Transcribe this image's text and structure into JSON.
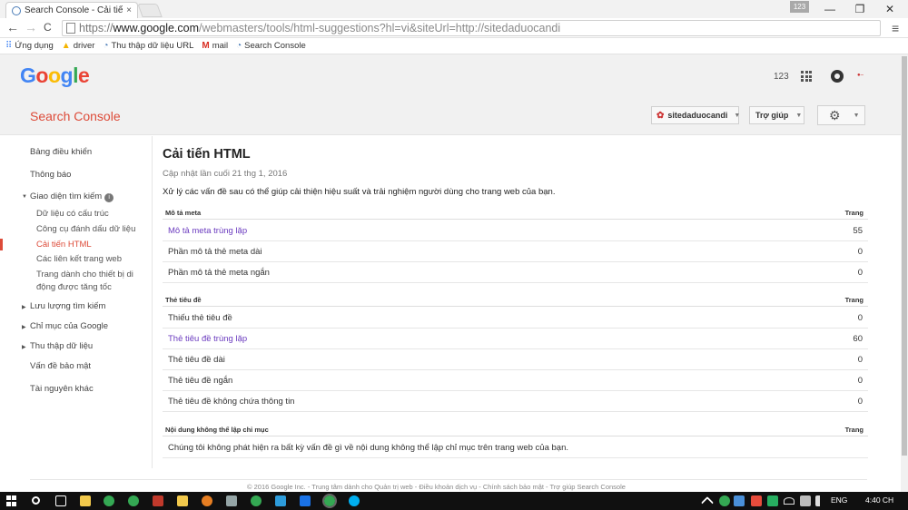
{
  "browser": {
    "tab_title": "Search Console - Cải tiến",
    "tab_close": "×",
    "profile_badge": "123",
    "win_minimize": "—",
    "win_maximize": "❐",
    "win_close": "✕",
    "nav_back": "←",
    "nav_forward": "→",
    "nav_reload": "C",
    "url_scheme": "https://",
    "url_host": "www.google.com",
    "url_rest": "/webmasters/tools/html-suggestions?hl=vi&siteUrl=http://sitedaduocandi",
    "menu": "≡"
  },
  "bookmarks": [
    {
      "label": "Ứng dụng",
      "icon": "apps-icon"
    },
    {
      "label": "driver",
      "icon": "drive-icon"
    },
    {
      "label": "Thu thập dữ liệu URL",
      "icon": "search-console-icon"
    },
    {
      "label": "mail",
      "icon": "gmail-icon"
    },
    {
      "label": "Search Console",
      "icon": "search-console-icon"
    }
  ],
  "header": {
    "logo_letters": [
      "G",
      "o",
      "o",
      "g",
      "l",
      "e"
    ],
    "logo_colors": [
      "#4285f4",
      "#ea4335",
      "#fbbc05",
      "#4285f4",
      "#34a853",
      "#ea4335"
    ],
    "count": "123",
    "brand": "Search Console",
    "site_selector": "sitedaduocandi",
    "help_label": "Trợ giúp",
    "caret": "▼",
    "gear": "⚙"
  },
  "sidebar": {
    "dashboard": "Bảng điều khiển",
    "messages": "Thông báo",
    "search_appearance": "Giao diện tìm kiếm",
    "info": "i",
    "sub": {
      "structured_data": "Dữ liệu có cấu trúc",
      "data_highlighter": "Công cụ đánh dấu dữ liệu",
      "html_improvements": "Cải tiến HTML",
      "sitelinks": "Các liên kết trang web",
      "amp_line1": "Trang dành cho thiết bị di",
      "amp_line2": "động được tăng tốc"
    },
    "search_traffic": "Lưu lượng tìm kiếm",
    "google_index": "Chỉ mục của Google",
    "crawl": "Thu thập dữ liệu",
    "security": "Vấn đề bảo mật",
    "other": "Tài nguyên khác",
    "expanded_arrow": "▼",
    "collapsed_arrow": "▶"
  },
  "main": {
    "title": "Cải tiến HTML",
    "updated": "Cập nhật lần cuối 21 thg 1, 2016",
    "intro": "Xử lý các vấn đề sau có thể giúp cải thiện hiệu suất và trải nghiệm người dùng cho trang web của bạn.",
    "sections": [
      {
        "heading": "Mô tả meta",
        "col": "Trang",
        "rows": [
          {
            "label": "Mô tả meta trùng lặp",
            "value": "55",
            "link": true
          },
          {
            "label": "Phần mô tả thẻ meta dài",
            "value": "0",
            "link": false
          },
          {
            "label": "Phần mô tả thẻ meta ngắn",
            "value": "0",
            "link": false
          }
        ]
      },
      {
        "heading": "Thẻ tiêu đề",
        "col": "Trang",
        "rows": [
          {
            "label": "Thiếu thẻ tiêu đề",
            "value": "0",
            "link": false
          },
          {
            "label": "Thẻ tiêu đề trùng lặp",
            "value": "60",
            "link": true
          },
          {
            "label": "Thẻ tiêu đề dài",
            "value": "0",
            "link": false
          },
          {
            "label": "Thẻ tiêu đề ngắn",
            "value": "0",
            "link": false
          },
          {
            "label": "Thẻ tiêu đề không chứa thông tin",
            "value": "0",
            "link": false
          }
        ]
      },
      {
        "heading": "Nội dung không thể lập chỉ mục",
        "col": "Trang",
        "message": "Chúng tôi không phát hiện ra bất kỳ vấn đề gì về nội dung không thể lập chỉ mục trên trang web của bạn."
      }
    ]
  },
  "footer": "© 2016 Google Inc. - Trung tâm dành cho Quản trị web - Điều khoản dịch vụ - Chính sách bảo mật - Trợ giúp Search Console",
  "taskbar": {
    "lang": "ENG",
    "time": "4:40 CH"
  }
}
